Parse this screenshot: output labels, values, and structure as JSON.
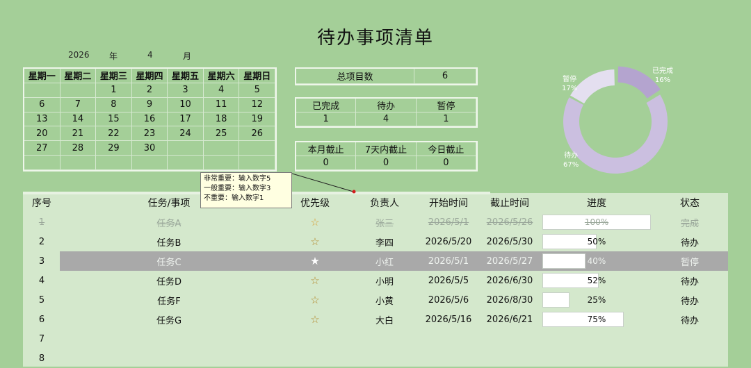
{
  "title": "待办事项清单",
  "year": "2026",
  "year_label": "年",
  "month": "4",
  "month_label": "月",
  "calendar": {
    "weekdays": [
      "星期一",
      "星期二",
      "星期三",
      "星期四",
      "星期五",
      "星期六",
      "星期日"
    ],
    "days": [
      "",
      "",
      "1",
      "2",
      "3",
      "4",
      "5",
      "6",
      "7",
      "8",
      "9",
      "10",
      "11",
      "12",
      "13",
      "14",
      "15",
      "16",
      "17",
      "18",
      "19",
      "20",
      "21",
      "22",
      "23",
      "24",
      "25",
      "26",
      "27",
      "28",
      "29",
      "30",
      "",
      "",
      "",
      "",
      "",
      "",
      "",
      "",
      "",
      ""
    ]
  },
  "summary": {
    "total_label": "总项目数",
    "total": "6"
  },
  "status_counts": {
    "labels": [
      "已完成",
      "待办",
      "暂停"
    ],
    "values": [
      "1",
      "4",
      "1"
    ]
  },
  "deadline_counts": {
    "labels": [
      "本月截止",
      "7天内截止",
      "今日截止"
    ],
    "values": [
      "0",
      "0",
      "0"
    ]
  },
  "donut": {
    "segments": [
      {
        "name": "已完成",
        "pct_label": "16%",
        "value": 16,
        "color": "#b4a4cf"
      },
      {
        "name": "待办",
        "pct_label": "67%",
        "value": 67,
        "color": "#cbbfe0"
      },
      {
        "name": "暂停",
        "pct_label": "17%",
        "value": 17,
        "color": "#e4dff0"
      }
    ]
  },
  "comment": [
    "非常重要：输入数字5",
    "一般重要：输入数字3",
    "不重要：输入数字1"
  ],
  "table": {
    "headers": {
      "seq": "序号",
      "task": "任务/事项",
      "priority": "优先级",
      "owner": "负责人",
      "start": "开始时间",
      "end": "截止时间",
      "progress": "进度",
      "status": "状态"
    },
    "rows": [
      {
        "seq": "1",
        "task": "任务A",
        "star": "☆",
        "owner": "张三",
        "start": "2026/5/1",
        "end": "2026/5/26",
        "progress_label": "100%",
        "progress": 1.0,
        "status": "完成",
        "kind": "done"
      },
      {
        "seq": "2",
        "task": "任务B",
        "star": "☆",
        "owner": "李四",
        "start": "2026/5/20",
        "end": "2026/5/30",
        "progress_label": "50%",
        "progress": 0.5,
        "status": "待办",
        "kind": "todo"
      },
      {
        "seq": "3",
        "task": "任务C",
        "star": "★",
        "owner": "小红",
        "start": "2026/5/1",
        "end": "2026/5/27",
        "progress_label": "40%",
        "progress": 0.4,
        "status": "暂停",
        "kind": "paused"
      },
      {
        "seq": "4",
        "task": "任务D",
        "star": "☆",
        "owner": "小明",
        "start": "2026/5/5",
        "end": "2026/6/30",
        "progress_label": "52%",
        "progress": 0.52,
        "status": "待办",
        "kind": "todo"
      },
      {
        "seq": "5",
        "task": "任务F",
        "star": "☆",
        "owner": "小黄",
        "start": "2026/5/6",
        "end": "2026/8/30",
        "progress_label": "25%",
        "progress": 0.25,
        "status": "待办",
        "kind": "todo"
      },
      {
        "seq": "6",
        "task": "任务G",
        "star": "☆",
        "owner": "大白",
        "start": "2026/5/16",
        "end": "2026/6/21",
        "progress_label": "75%",
        "progress": 0.75,
        "status": "待办",
        "kind": "todo"
      },
      {
        "seq": "7",
        "task": "",
        "star": "",
        "owner": "",
        "start": "",
        "end": "",
        "progress_label": "",
        "progress": 0,
        "status": "",
        "kind": "empty"
      },
      {
        "seq": "8",
        "task": "",
        "star": "",
        "owner": "",
        "start": "",
        "end": "",
        "progress_label": "",
        "progress": 0,
        "status": "",
        "kind": "empty"
      }
    ]
  }
}
